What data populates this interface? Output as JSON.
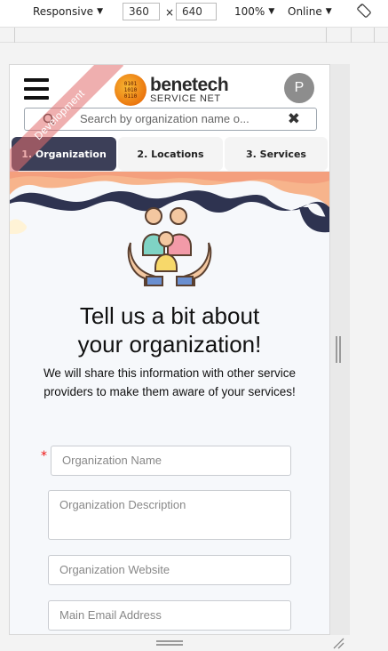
{
  "devtools": {
    "device_mode": "Responsive",
    "width": "360",
    "times": "×",
    "height": "640",
    "zoom": "100%",
    "network": "Online"
  },
  "header": {
    "logo_main": "benetech",
    "logo_sub": "SERVICE NET",
    "avatar_initial": "P",
    "search_placeholder": "Search by organization name o...",
    "search_clear": "✖",
    "dev_banner": "Development"
  },
  "tabs": [
    {
      "label": "1. Organization",
      "active": true
    },
    {
      "label": "2. Locations",
      "active": false
    },
    {
      "label": "3. Services",
      "active": false
    }
  ],
  "main": {
    "title_line1": "Tell us a bit about",
    "title_line2": "your organization!",
    "subtitle": "We will share this information with other service providers to make them aware of your services!",
    "required_mark": "*",
    "fields": [
      {
        "placeholder": "Organization Name"
      },
      {
        "placeholder": "Organization Description"
      },
      {
        "placeholder": "Organization Website"
      },
      {
        "placeholder": "Main Email Address"
      }
    ]
  },
  "colors": {
    "active_tab": "#3c3f58",
    "wave_peach": "#f7b48c",
    "wave_navy": "#2e3350",
    "required": "#e11111"
  }
}
